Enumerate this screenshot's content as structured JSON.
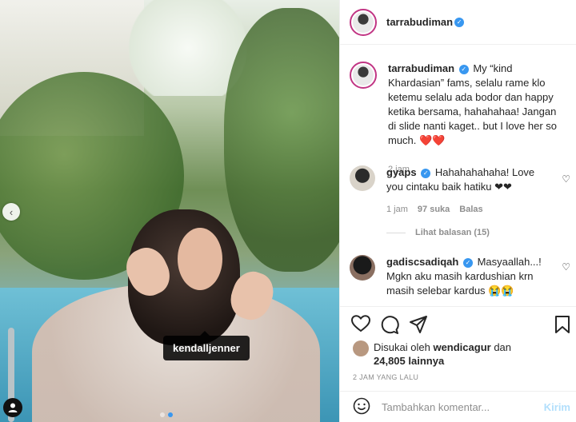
{
  "post": {
    "tag_label": "kendalljenner",
    "carousel_dots": 2,
    "active_dot": 1
  },
  "header": {
    "username": "tarrabudiman"
  },
  "caption": {
    "username": "tarrabudiman",
    "text": "My “kind Khardasian” fams, selalu rame klo ketemu selalu ada bodor dan happy ketika bersama, hahahahaa! Jangan di slide nanti kaget.. but I love her so much. ❤️❤️",
    "time": "2 jam"
  },
  "comments": [
    {
      "username": "gyaps",
      "text": "Hahahahahaha! Love you cintaku baik hatiku ❤❤",
      "time": "1 jam",
      "likes": "97 suka",
      "reply_label": "Balas",
      "view_replies": "Lihat balasan (15)"
    },
    {
      "username": "gadiscsadiqah",
      "text": "Masyaallah...! Mgkn aku masih kardushian krn masih selebar kardus 😭😭"
    }
  ],
  "likes": {
    "prefix": "Disukai oleh",
    "user": "wendicagur",
    "conjunction": "dan",
    "count": "24,805 lainnya"
  },
  "timestamp": "2 JAM YANG LALU",
  "comment_box": {
    "placeholder": "Tambahkan komentar...",
    "post_label": "Kirim"
  },
  "colors": {
    "verified": "#3897f0",
    "post_button": "#b2dffc"
  }
}
